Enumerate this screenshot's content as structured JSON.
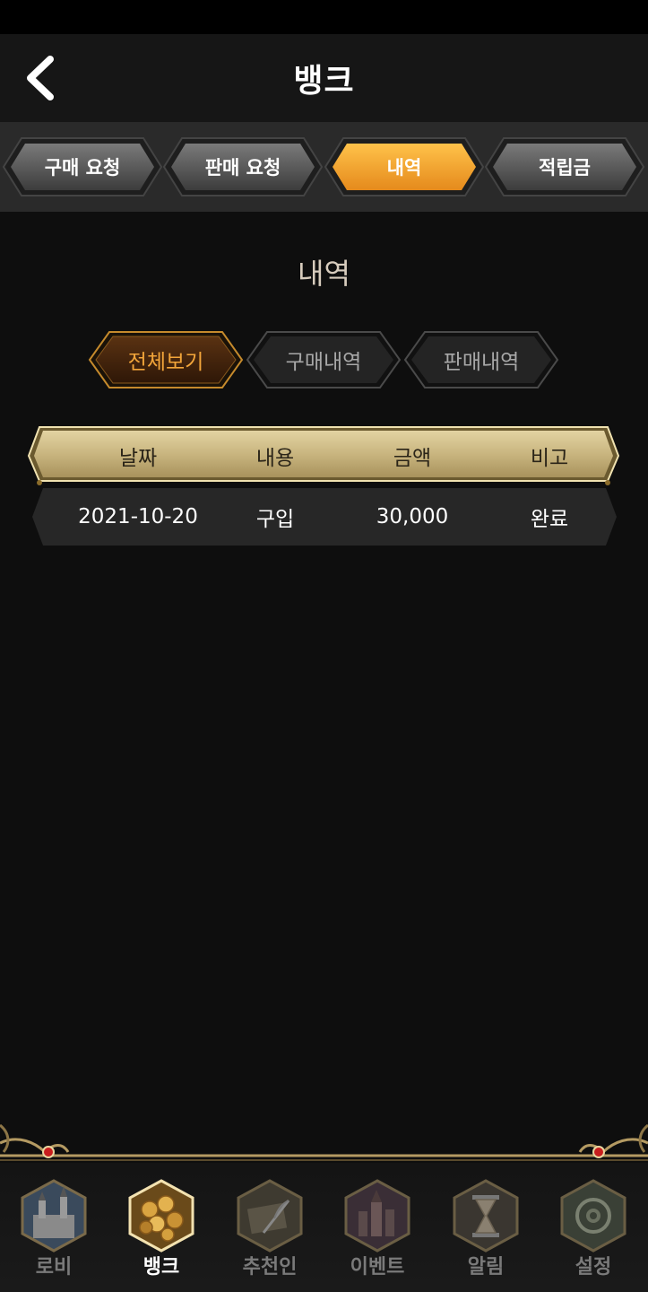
{
  "header": {
    "title": "뱅크"
  },
  "tabs": [
    {
      "label": "구매 요청",
      "active": false
    },
    {
      "label": "판매 요청",
      "active": false
    },
    {
      "label": "내역",
      "active": true
    },
    {
      "label": "적립금",
      "active": false
    }
  ],
  "section": {
    "title": "내역"
  },
  "filters": [
    {
      "label": "전체보기",
      "active": true
    },
    {
      "label": "구매내역",
      "active": false
    },
    {
      "label": "판매내역",
      "active": false
    }
  ],
  "table": {
    "headers": [
      "날짜",
      "내용",
      "금액",
      "비고"
    ],
    "rows": [
      [
        "2021-10-20",
        "구입",
        "30,000",
        "완료"
      ]
    ]
  },
  "nav": [
    {
      "label": "로비",
      "icon": "castle-icon",
      "active": false
    },
    {
      "label": "뱅크",
      "icon": "coins-icon",
      "active": true
    },
    {
      "label": "추천인",
      "icon": "quill-icon",
      "active": false
    },
    {
      "label": "이벤트",
      "icon": "city-icon",
      "active": false
    },
    {
      "label": "알림",
      "icon": "hourglass-icon",
      "active": false
    },
    {
      "label": "설정",
      "icon": "settings-icon",
      "active": false
    }
  ],
  "colors": {
    "accent": "#f0a030",
    "gold": "#c9b57f",
    "active_filter_text": "#f2a53a"
  }
}
